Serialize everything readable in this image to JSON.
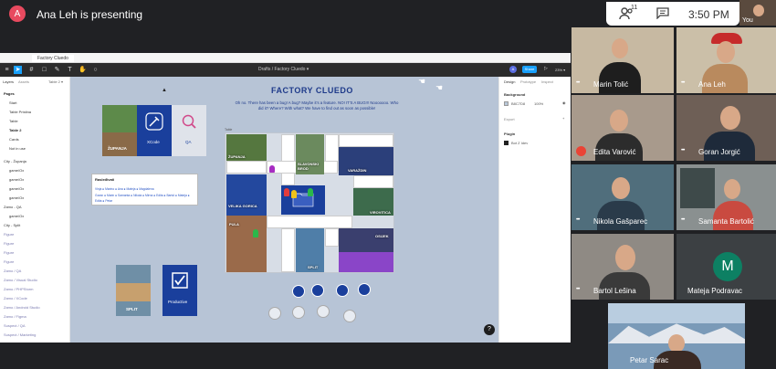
{
  "meeting": {
    "presenter_initial": "A",
    "presenting_text": "Ana Leh is presenting",
    "participant_count": "11",
    "time": "3:50 PM",
    "self_label": "You"
  },
  "figma": {
    "tab_title": "Factory Cluedo",
    "breadcrumb": "Drafts / Factory Cluedo ▾",
    "share_label": "Share",
    "zoom": "23% ▾",
    "user_initial": "A",
    "left_panel": {
      "tab_layers": "Layers",
      "tab_assets": "Assets",
      "tab_page": "Table 2 ▾",
      "pages_header": "Pages",
      "pages": [
        "Start",
        "Table Pristina",
        "Table",
        "Table 2",
        "Cards",
        "Not in use"
      ],
      "layers": [
        "City - Županja",
        "game/Ox",
        "game/Ox",
        "game/Ox",
        "game/Ox",
        "Zamo - QA",
        "game/Ox",
        "City - Split",
        "Figure",
        "Figure",
        "Figure",
        "Figure",
        "Zamo / QA",
        "Zamo / Visual Studio",
        "Zamo / PHPStorm",
        "Zamo / XCode",
        "Zamo / Android Studio",
        "Zamo / Figma",
        "Suspect / QA",
        "Suspect / Marketing"
      ]
    },
    "right_panel": {
      "tab_design": "Design",
      "tab_prototype": "Prototype",
      "tab_inspect": "Inspect",
      "background_label": "Background",
      "bg_hex": "B8C7D8",
      "bg_opacity": "100%",
      "export_label": "Export",
      "plugin_label": "Plugin",
      "plugin_name": "Bot Z Idev"
    },
    "canvas": {
      "title": "FACTORY CLUEDO",
      "subtitle": "Oh no. There has been a bug! A bug? Maybe it's a feature. NO! IT'S A BUG!!! Nooooooo. Who did it? Where? With what? We have to find out as soon as possible!",
      "board_label": "Table",
      "cards": {
        "zupanja": "ŽUPANJA",
        "xcode": "XCode",
        "qa": "QA",
        "split": "SPLIT",
        "productive": "Productive"
      },
      "tiles": {
        "zupanja": "ŽUPANJA",
        "slavonski_brod": "SLAVONSKI BROD",
        "varazdin": "VARAŽDIN",
        "velika_gorica": "VELIKA GORICA",
        "virovitica": "VIROVITICA",
        "pula": "PULA",
        "osijek": "OSIJEK",
        "split": "SPLIT"
      },
      "note": {
        "title": "Rasleđivati",
        "line1": "Vinja ● Marino ● Ana ● Mateja ● Magdalena",
        "line2": "Goran ● Marin ● Samanta ● Nikola ● Mirna ● Edita ● Bartol ● Mateja ●",
        "line3": "Edita ● Petar"
      },
      "help": "?"
    }
  },
  "participants": [
    {
      "name": "Marin Tolić"
    },
    {
      "name": "Ana Leh"
    },
    {
      "name": "Edita Varović"
    },
    {
      "name": "Goran Jorgić"
    },
    {
      "name": "Nikola Gašparec"
    },
    {
      "name": "Samanta Bartolić"
    },
    {
      "name": "Bartol Lešina"
    },
    {
      "name": "Mateja Podravac",
      "initial": "M"
    },
    {
      "name": "Petar Sarac"
    }
  ]
}
